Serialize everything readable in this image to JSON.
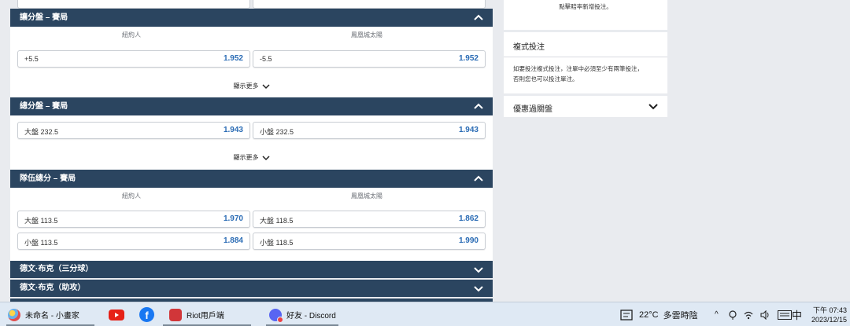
{
  "top_right_note": "點擊賠率新增投注。",
  "sections": [
    {
      "title": "讓分盤 – 賽局",
      "teams": [
        "紐約人",
        "鳳凰城太陽"
      ],
      "rows": [
        [
          {
            "label": "+5.5",
            "odds": "1.952"
          },
          {
            "label": "-5.5",
            "odds": "1.952"
          }
        ]
      ],
      "more": "顯示更多"
    },
    {
      "title": "總分盤 – 賽局",
      "rows": [
        [
          {
            "label": "大盤 232.5",
            "odds": "1.943"
          },
          {
            "label": "小盤 232.5",
            "odds": "1.943"
          }
        ]
      ],
      "more": "顯示更多"
    },
    {
      "title": "隊伍總分 – 賽局",
      "teams": [
        "紐約人",
        "鳳凰城太陽"
      ],
      "rows": [
        [
          {
            "label": "大盤 113.5",
            "odds": "1.970"
          },
          {
            "label": "大盤 118.5",
            "odds": "1.862"
          }
        ],
        [
          {
            "label": "小盤 113.5",
            "odds": "1.884"
          },
          {
            "label": "小盤 118.5",
            "odds": "1.990"
          }
        ]
      ]
    },
    {
      "title": "德文·布克（三分球）"
    },
    {
      "title": "德文·布克（助攻）"
    }
  ],
  "right": {
    "multi_title": "複式投注",
    "multi_text_1": "如要投注複式投注，注單中必須至少有兩筆投注，",
    "multi_text_2": "否則您也可以投注單注。",
    "promo_title": "優惠過關盤"
  },
  "taskbar": {
    "apps": [
      {
        "label": "未命名 - 小畫家",
        "icon": "paint-icon"
      },
      {
        "label": "",
        "icon": "youtube-icon"
      },
      {
        "label": "",
        "icon": "facebook-icon"
      },
      {
        "label": "Riot用戶端",
        "icon": "riot-icon"
      },
      {
        "label": "好友 - Discord",
        "icon": "discord-icon"
      }
    ],
    "weather_temp": "22°C",
    "weather_desc": "多雲時陰",
    "tray_up": "^",
    "ime": "中",
    "time": "下午 07:43",
    "date": "2023/12/15"
  },
  "colors": {
    "header": "#2b4560",
    "odds": "#2b6cb5",
    "taskbar": "#dfe9f4"
  }
}
